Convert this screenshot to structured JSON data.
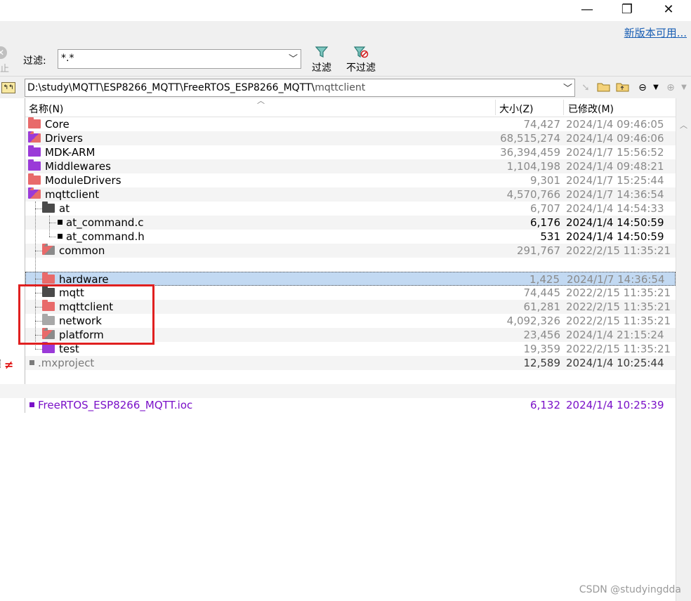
{
  "window": {
    "minimize_glyph": "—",
    "maximize_glyph": "❐",
    "close_glyph": "✕",
    "update_link": "新版本可用..."
  },
  "toolbar": {
    "stop_label": "止",
    "filter_label": "过滤:",
    "filter_value": "*.*",
    "filter_button": "过滤",
    "no_filter_button": "不过滤"
  },
  "path": {
    "prefix": "D:\\study\\MQTT\\ESP8266_MQTT\\FreeRTOS_ESP8266_MQTT\\",
    "last": "mqttclient"
  },
  "columns": {
    "name": "名称(N)",
    "size": "大小(Z)",
    "modified": "已修改(M)"
  },
  "rows": [
    {
      "name": "Core",
      "size": "74,427",
      "date": "2024/1/4 09:46:05"
    },
    {
      "name": "Drivers",
      "size": "68,515,274",
      "date": "2024/1/4 09:46:06"
    },
    {
      "name": "MDK-ARM",
      "size": "36,394,459",
      "date": "2024/1/7 15:56:52"
    },
    {
      "name": "Middlewares",
      "size": "1,104,198",
      "date": "2024/1/4 09:48:21"
    },
    {
      "name": "ModuleDrivers",
      "size": "9,301",
      "date": "2024/1/7 15:25:44"
    },
    {
      "name": "mqttclient",
      "size": "4,570,766",
      "date": "2024/1/7 14:36:54"
    },
    {
      "name": "at",
      "size": "6,707",
      "date": "2024/1/4 14:54:33"
    },
    {
      "name": "at_command.c",
      "size": "6,176",
      "date": "2024/1/4 14:50:59"
    },
    {
      "name": "at_command.h",
      "size": "531",
      "date": "2024/1/4 14:50:59"
    },
    {
      "name": "common",
      "size": "291,767",
      "date": "2022/2/15 11:35:21"
    },
    {
      "name": "hardware",
      "size": "1,425",
      "date": "2024/1/7 14:36:54"
    },
    {
      "name": "mqtt",
      "size": "74,445",
      "date": "2022/2/15 11:35:21"
    },
    {
      "name": "mqttclient",
      "size": "61,281",
      "date": "2022/2/15 11:35:21"
    },
    {
      "name": "network",
      "size": "4,092,326",
      "date": "2022/2/15 11:35:21"
    },
    {
      "name": "platform",
      "size": "23,456",
      "date": "2024/1/4 21:15:24"
    },
    {
      "name": "test",
      "size": "19,359",
      "date": "2022/2/15 11:35:21"
    },
    {
      "name": ".mxproject",
      "size": "12,589",
      "date": "2024/1/4 10:25:44"
    },
    {
      "name": "FreeRTOS_ESP8266_MQTT.ioc",
      "size": "6,132",
      "date": "2024/1/4 10:25:39"
    }
  ],
  "diff_marker": "≠",
  "watermark": "CSDN @studyingdda",
  "colors": {
    "highlight_box": "#e02020",
    "selected_row": "#c2d9f2",
    "purple_file": "#7a10c8",
    "link": "#1a5fb4"
  }
}
